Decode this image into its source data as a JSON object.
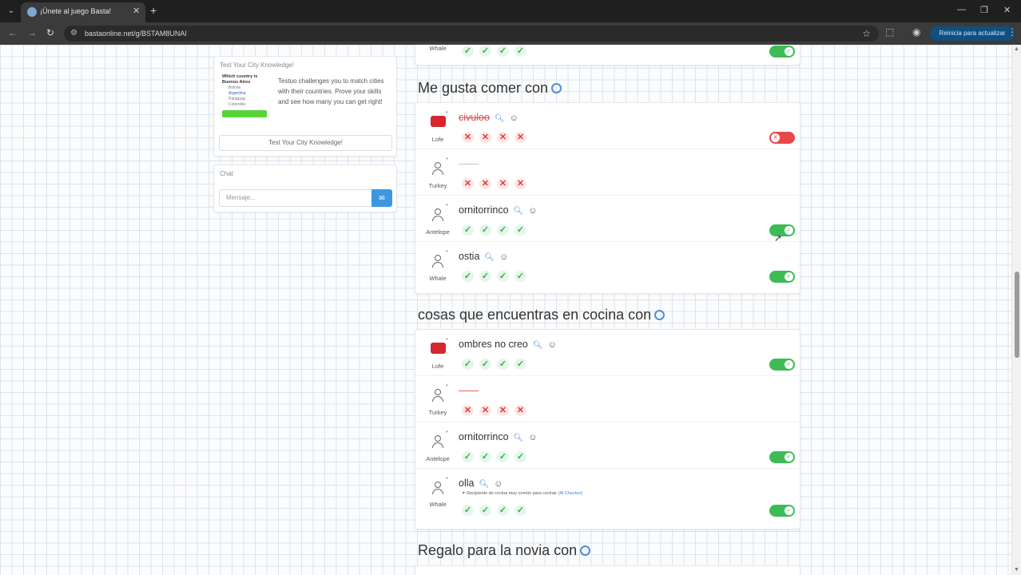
{
  "browser": {
    "tab_title": "¡Únete al juego Basta!",
    "url": "bastaonline.net/g/BSTAM8UNAI",
    "update_label": "Reinicia para actualizar"
  },
  "ad": {
    "title": "Test Your City Knowledge!",
    "preview_title": "Which country is Buenos Aires",
    "preview_options": [
      "Bolivia",
      "Argentina",
      "Paraguay",
      "Colombia"
    ],
    "text": "Testuo challenges you to match cities with their countries. Prove your skills and see how many you can get right!",
    "button": "Test Your City Knowledge!"
  },
  "chat": {
    "title": "Chat",
    "placeholder": "Mensaje..."
  },
  "top_row": {
    "name": "Whale"
  },
  "sections": [
    {
      "title": "Me gusta comer con",
      "rows": [
        {
          "player": "Lofe",
          "avatar": "logo-icon",
          "word": "civuloo",
          "state": "struck",
          "marks": [
            "x",
            "x",
            "x",
            "x"
          ],
          "toggle": "off"
        },
        {
          "player": "Turkey",
          "avatar": "user-icon",
          "word": "——",
          "state": "greydash",
          "marks": [
            "x",
            "x",
            "x",
            "x"
          ],
          "toggle": "none"
        },
        {
          "player": "Antelope",
          "avatar": "user-icon",
          "word": "ornitorrinco",
          "state": "normal",
          "marks": [
            "v",
            "v",
            "v",
            "v"
          ],
          "toggle": "on"
        },
        {
          "player": "Whale",
          "avatar": "user-icon",
          "word": "ostia",
          "state": "normal",
          "marks": [
            "v",
            "v",
            "v",
            "v"
          ],
          "toggle": "on"
        }
      ]
    },
    {
      "title": "cosas que encuentras en cocina con",
      "rows": [
        {
          "player": "Lofe",
          "avatar": "logo-icon",
          "word": "ombres no creo",
          "state": "normal",
          "marks": [
            "v",
            "v",
            "v",
            "v"
          ],
          "toggle": "on"
        },
        {
          "player": "Turkey",
          "avatar": "user-icon",
          "word": "——",
          "state": "dash",
          "marks": [
            "x",
            "x",
            "x",
            "x"
          ],
          "toggle": "none"
        },
        {
          "player": "Antelope",
          "avatar": "user-icon",
          "word": "ornitorrinco",
          "state": "normal",
          "marks": [
            "v",
            "v",
            "v",
            "v"
          ],
          "toggle": "on"
        },
        {
          "player": "Whale",
          "avatar": "user-icon",
          "word": "olla",
          "state": "normal",
          "note": "Recipiente de cocina muy común para cocinar",
          "note_src": "(AI Checker)",
          "marks": [
            "v",
            "v",
            "v",
            "v"
          ],
          "toggle": "on"
        }
      ]
    },
    {
      "title": "Regalo para la novia con",
      "rows": []
    }
  ],
  "colors": {
    "ok": "#2fb34a",
    "bad": "#e03a3a",
    "toggle_on": "#3dbb56",
    "toggle_off": "#e94747",
    "accent": "#4a90d9"
  }
}
